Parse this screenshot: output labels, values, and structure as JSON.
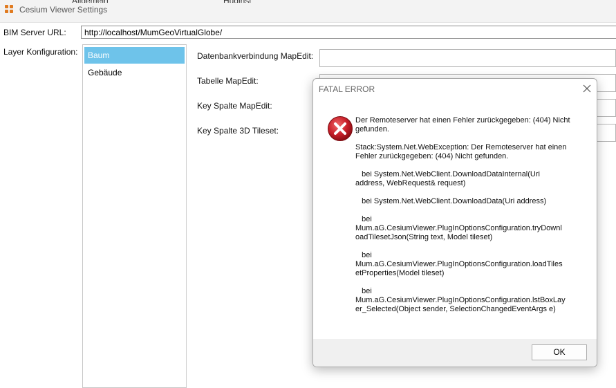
{
  "window": {
    "title": "Cesium Viewer Settings",
    "icon": "app-icon",
    "cut_labels": [
      "Allgemein",
      "Huginsi"
    ]
  },
  "form": {
    "bim_url_label": "BIM Server URL:",
    "bim_url_value": "http://localhost/MumGeoVirtualGlobe/",
    "layer_label": "Layer Konfiguration:",
    "layers": [
      {
        "label": "Baum",
        "selected": true
      },
      {
        "label": "Gebäude",
        "selected": false
      }
    ],
    "fields": [
      {
        "label": "Datenbankverbindung MapEdit:",
        "value": ""
      },
      {
        "label": "Tabelle MapEdit:",
        "value": ""
      },
      {
        "label": "Key Spalte MapEdit:",
        "value": ""
      },
      {
        "label": "Key Spalte 3D Tileset:",
        "value": ""
      }
    ]
  },
  "dialog": {
    "title": "FATAL ERROR",
    "close_icon": "close-icon",
    "error_icon": "error-icon",
    "message": {
      "line1": "Der Remoteserver hat einen Fehler zurückgegeben: (404) Nicht",
      "line2": "gefunden.",
      "stack1": "Stack:System.Net.WebException: Der Remoteserver hat einen",
      "stack2": "Fehler zurückgegeben: (404) Nicht gefunden.",
      "frame1a": "   bei System.Net.WebClient.DownloadDataInternal(Uri",
      "frame1b": "address, WebRequest& request)",
      "frame2": "   bei System.Net.WebClient.DownloadData(Uri address)",
      "frame3a": "   bei",
      "frame3b": "Mum.aG.CesiumViewer.PlugInOptionsConfiguration.tryDownl",
      "frame3c": "oadTilesetJson(String text, Model tileset)",
      "frame4a": "   bei",
      "frame4b": "Mum.aG.CesiumViewer.PlugInOptionsConfiguration.loadTiles",
      "frame4c": "etProperties(Model tileset)",
      "frame5a": "   bei",
      "frame5b": "Mum.aG.CesiumViewer.PlugInOptionsConfiguration.lstBoxLay",
      "frame5c": "er_Selected(Object sender, SelectionChangedEventArgs e)"
    },
    "ok_label": "OK"
  },
  "colors": {
    "selection": "#6ec3ea",
    "error_red": "#c8202a",
    "app_icon": "#e07a1f"
  }
}
